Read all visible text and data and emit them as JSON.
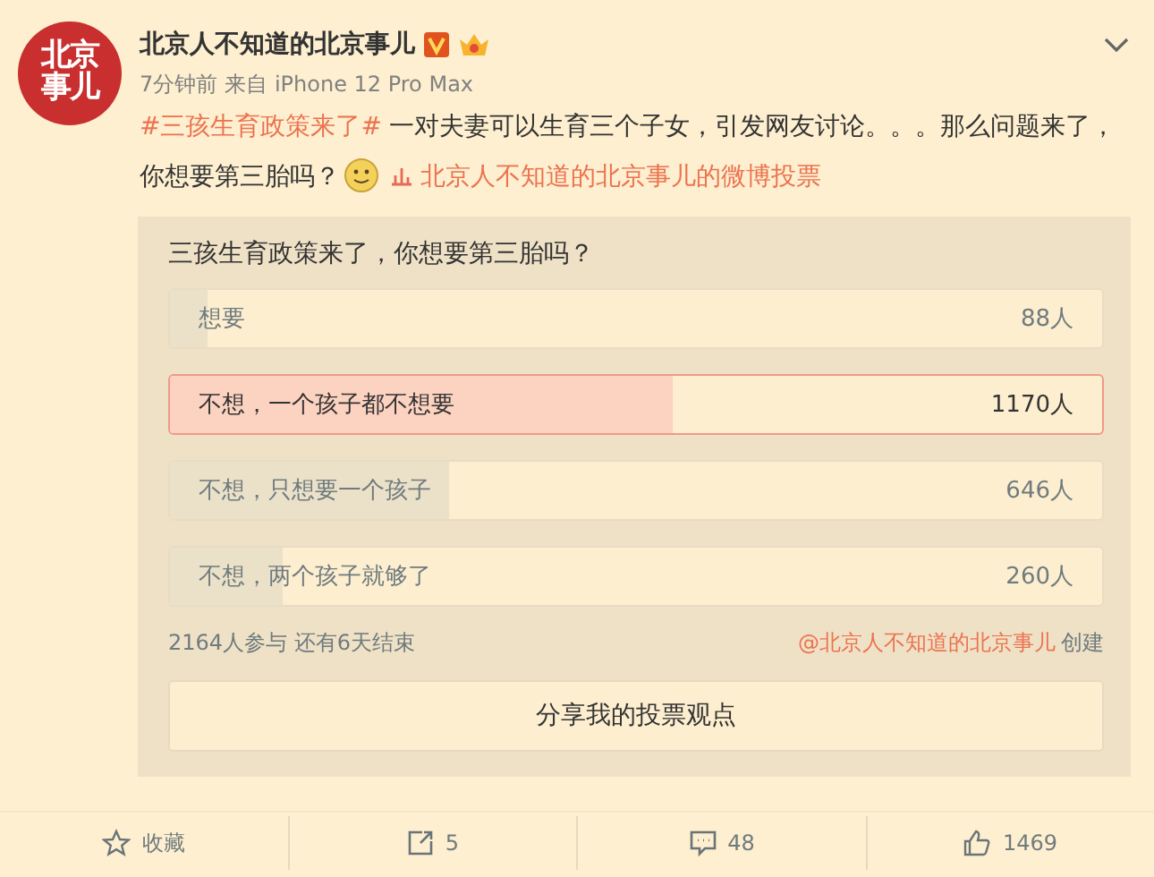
{
  "post": {
    "avatar": {
      "line_1": "北京",
      "line_2": "事儿"
    },
    "author": "北京人不知道的北京事儿",
    "time": "7分钟前",
    "source": "来自 iPhone 12 Pro Max",
    "hashtag": "#三孩生育政策来了#",
    "text": "一对夫妻可以生育三个子女，引发网友讨论。。。那么问题来了，你想要第三胎吗？",
    "poll_link": "北京人不知道的北京事儿的微博投票"
  },
  "poll": {
    "question": "三孩生育政策来了，你想要第三胎吗？",
    "options": [
      {
        "label": "想要",
        "count": "88人",
        "level": 0.04,
        "selected": false
      },
      {
        "label": "不想，一个孩子都不想要",
        "count": "1170人",
        "level": 0.54,
        "selected": true
      },
      {
        "label": "不想，只想要一个孩子",
        "count": "646人",
        "level": 0.3,
        "selected": false
      },
      {
        "label": "不想，两个孩子就够了",
        "count": "260人",
        "level": 0.12,
        "selected": false
      }
    ],
    "summary": "2164人参与 还有6天结束",
    "creator": "@北京人不知道的北京事儿",
    "created": "创建",
    "share_button": "分享我的投票观点"
  },
  "actions": [
    {
      "kind": "favorite",
      "label": "收藏"
    },
    {
      "kind": "repost",
      "label": "5"
    },
    {
      "kind": "comment",
      "label": "48"
    },
    {
      "kind": "like",
      "label": "1469"
    }
  ]
}
